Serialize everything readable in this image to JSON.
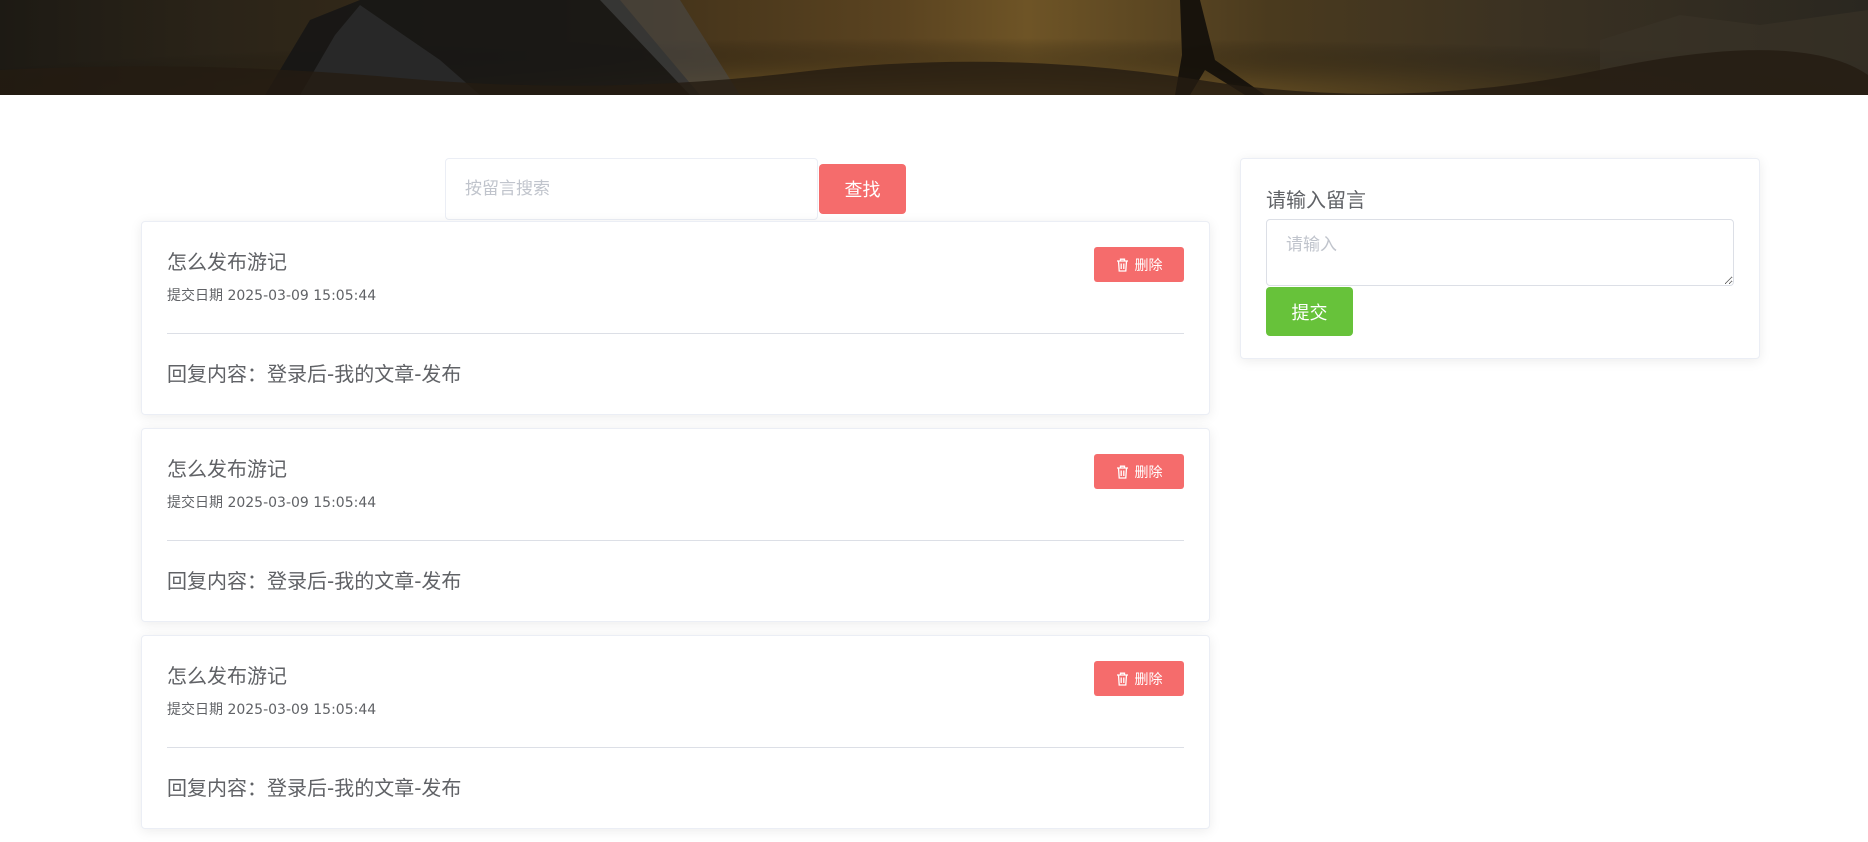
{
  "colors": {
    "danger": "#f56c6c",
    "success": "#67c23a",
    "text": "#606266",
    "placeholder": "#c0c4cc"
  },
  "search": {
    "placeholder": "按留言搜索",
    "button_label": "查找"
  },
  "messages": [
    {
      "title": "怎么发布游记",
      "date": "提交日期 2025-03-09 15:05:44",
      "reply": "回复内容：登录后-我的文章-发布",
      "delete_label": "删除",
      "delete_icon": "trash-icon"
    },
    {
      "title": "怎么发布游记",
      "date": "提交日期 2025-03-09 15:05:44",
      "reply": "回复内容：登录后-我的文章-发布",
      "delete_label": "删除",
      "delete_icon": "trash-icon"
    },
    {
      "title": "怎么发布游记",
      "date": "提交日期 2025-03-09 15:05:44",
      "reply": "回复内容：登录后-我的文章-发布",
      "delete_label": "删除",
      "delete_icon": "trash-icon"
    }
  ],
  "compose": {
    "label": "请输入留言",
    "placeholder": "请输入",
    "submit_label": "提交"
  }
}
